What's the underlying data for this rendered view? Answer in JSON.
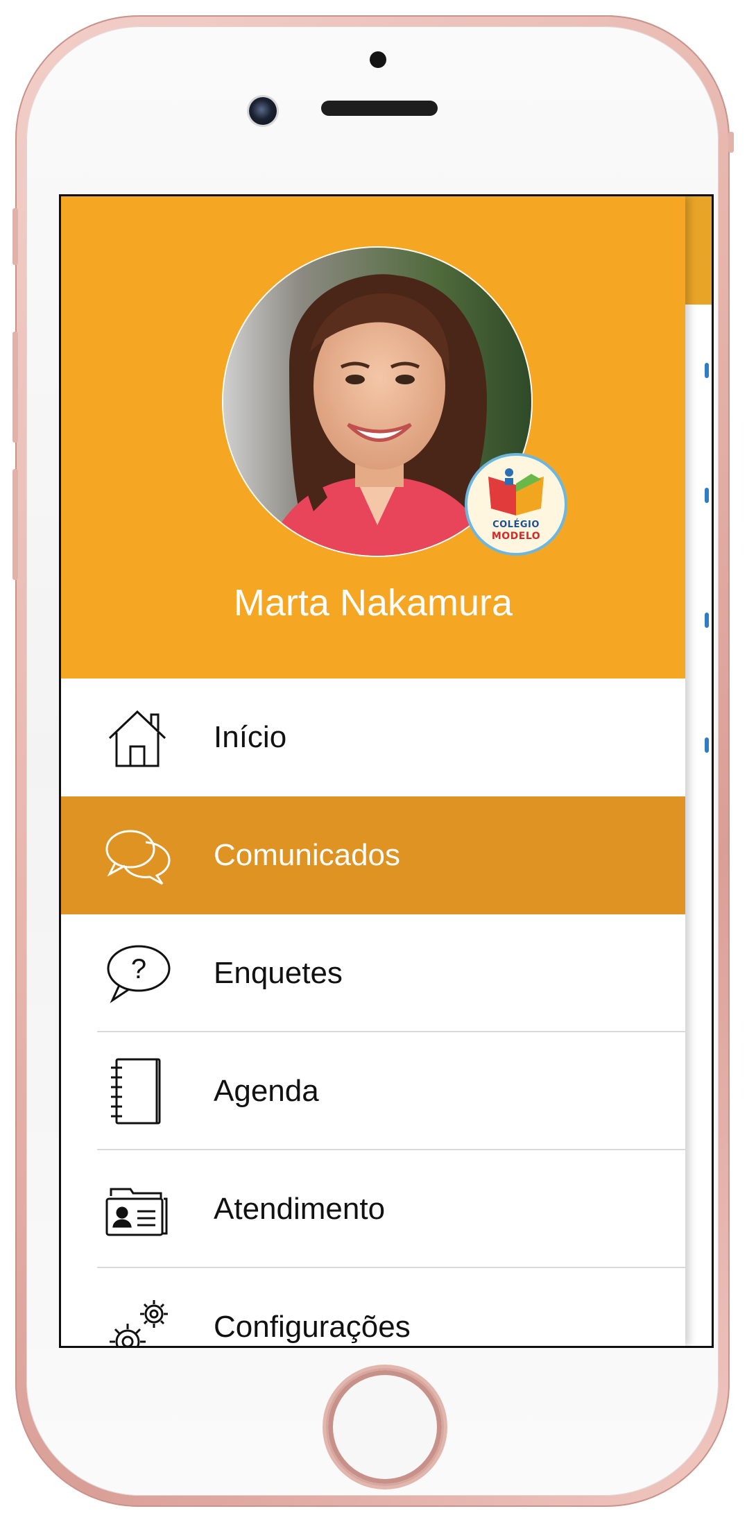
{
  "user": {
    "name": "Marta Nakamura",
    "badge_line1": "COLÉGIO",
    "badge_line2": "MODELO"
  },
  "menu": {
    "items": [
      {
        "label": "Início",
        "icon": "home-icon",
        "active": false
      },
      {
        "label": "Comunicados",
        "icon": "chat-bubbles-icon",
        "active": true
      },
      {
        "label": "Enquetes",
        "icon": "question-bubble-icon",
        "active": false
      },
      {
        "label": "Agenda",
        "icon": "notebook-icon",
        "active": false
      },
      {
        "label": "Atendimento",
        "icon": "contact-cards-icon",
        "active": false
      },
      {
        "label": "Configurações",
        "icon": "gears-icon",
        "active": false
      }
    ]
  },
  "colors": {
    "header": "#f5a623",
    "active_item": "#de9323",
    "text": "#111111",
    "active_text": "#ffffff"
  }
}
